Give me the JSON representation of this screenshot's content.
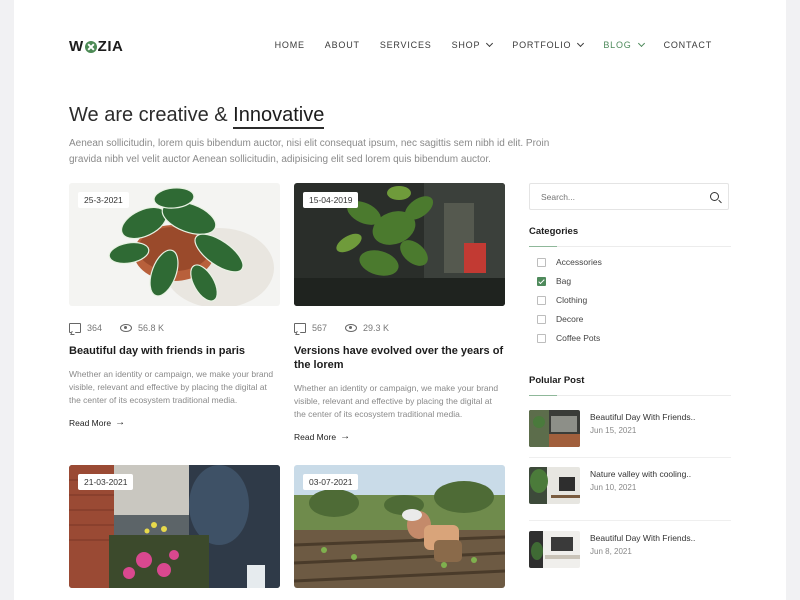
{
  "brand": {
    "logo_left": "W",
    "logo_right": "ZIA",
    "accent": "#4e8a5b"
  },
  "nav": [
    {
      "label": "HOME",
      "dropdown": false,
      "active": false
    },
    {
      "label": "ABOUT",
      "dropdown": false,
      "active": false
    },
    {
      "label": "SERVICES",
      "dropdown": false,
      "active": false
    },
    {
      "label": "SHOP",
      "dropdown": true,
      "active": false
    },
    {
      "label": "PORTFOLIO",
      "dropdown": true,
      "active": false
    },
    {
      "label": "BLOG",
      "dropdown": true,
      "active": true
    },
    {
      "label": "CONTACT",
      "dropdown": false,
      "active": false
    }
  ],
  "hero": {
    "title_plain": "We are creative & ",
    "title_strong": "Innovative",
    "description": "Aenean sollicitudin, lorem quis bibendum auctor, nisi elit consequat ipsum, nec sagittis sem nibh id elit. Proin gravida nibh vel velit auctor Aenean sollicitudin, adipisicing elit sed lorem quis bibendum auctor."
  },
  "posts": [
    {
      "date": "25-3-2021",
      "comments": "364",
      "views": "56.8 K",
      "title": "Beautiful day with friends in paris",
      "excerpt": "Whether an identity or campaign, we make your brand visible, relevant and effective by placing the digital at the center of its ecosystem traditional media.",
      "read_more": "Read More",
      "image": "white-bg-nerve-plant"
    },
    {
      "date": "15-04-2019",
      "comments": "567",
      "views": "29.3 K",
      "title": "Versions have evolved over the years of the lorem",
      "excerpt": "Whether an identity or campaign, we make your brand visible, relevant and effective by placing the digital at the center of its ecosystem traditional media.",
      "read_more": "Read More",
      "image": "dark-basil-plant"
    },
    {
      "date": "21-03-2021",
      "image": "people-gardening-flowers"
    },
    {
      "date": "03-07-2021",
      "image": "woman-farming-field"
    }
  ],
  "sidebar": {
    "search_placeholder": "Search...",
    "categories_title": "Categories",
    "categories": [
      {
        "label": "Accessories",
        "checked": false
      },
      {
        "label": "Bag",
        "checked": true
      },
      {
        "label": "Clothing",
        "checked": false
      },
      {
        "label": "Decore",
        "checked": false
      },
      {
        "label": "Coffee Pots",
        "checked": false
      }
    ],
    "popular_title": "Polular Post",
    "popular": [
      {
        "title": "Beautiful Day With Friends..",
        "date": "Jun 15, 2021"
      },
      {
        "title": "Nature valley with cooling..",
        "date": "Jun 10, 2021"
      },
      {
        "title": "Beautiful Day With Friends..",
        "date": "Jun 8, 2021"
      }
    ]
  }
}
